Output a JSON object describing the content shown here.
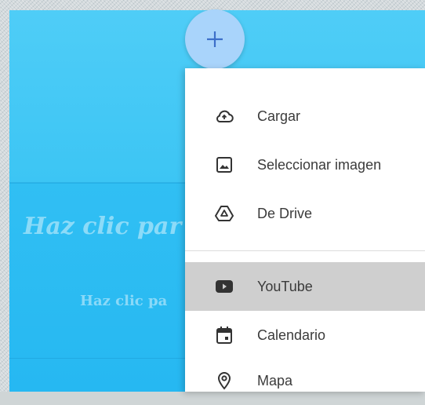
{
  "canvas": {
    "title": "Haz clic par",
    "subtitle": "Haz clic pa"
  },
  "fab": {
    "label": "+",
    "icon": "plus-icon"
  },
  "menu": {
    "items": [
      {
        "label": "Cargar",
        "icon": "cloud-upload-icon",
        "highlighted": false
      },
      {
        "label": "Seleccionar imagen",
        "icon": "image-icon",
        "highlighted": false
      },
      {
        "label": "De Drive",
        "icon": "drive-icon",
        "highlighted": false
      },
      {
        "label": "YouTube",
        "icon": "youtube-icon",
        "highlighted": true
      },
      {
        "label": "Calendario",
        "icon": "calendar-icon",
        "highlighted": false
      },
      {
        "label": "Mapa",
        "icon": "map-pin-icon",
        "highlighted": false
      }
    ]
  },
  "colors": {
    "canvas": "#31bff3",
    "fab": "#a9d4fb",
    "highlight": "#cfcfcf",
    "icon": "#333333"
  }
}
